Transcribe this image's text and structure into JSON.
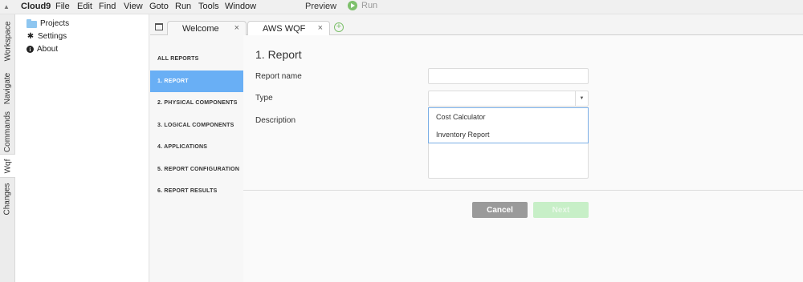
{
  "menubar": {
    "brand": "Cloud9",
    "menus": [
      "File",
      "Edit",
      "Find",
      "View",
      "Goto",
      "Run",
      "Tools",
      "Window"
    ],
    "preview": "Preview",
    "run": "Run",
    "run_icon": "play-icon"
  },
  "side_tabs": [
    "Workspace",
    "Navigate",
    "Commands",
    "Wqf",
    "Changes"
  ],
  "tree": {
    "items": [
      {
        "label": "Projects",
        "icon": "folder-icon"
      },
      {
        "label": "Settings",
        "icon": "gear-icon"
      },
      {
        "label": "About",
        "icon": "info-icon"
      }
    ]
  },
  "tabs": [
    {
      "label": "Welcome",
      "close": "×"
    },
    {
      "label": "AWS WQF",
      "close": "×"
    }
  ],
  "add_tab": "+",
  "steps": [
    "ALL REPORTS",
    "1. REPORT",
    "2. PHYSICAL COMPONENTS",
    "3. LOGICAL COMPONENTS",
    "4. APPLICATIONS",
    "5. REPORT CONFIGURATION",
    "6. REPORT RESULTS"
  ],
  "active_step": "1. REPORT",
  "form": {
    "heading": "1. Report",
    "report_name_label": "Report name",
    "report_name_value": "",
    "type_label": "Type",
    "type_value": "",
    "description_label": "Description",
    "type_options": [
      "Cost Calculator",
      "Inventory Report"
    ]
  },
  "buttons": {
    "cancel": "Cancel",
    "next": "Next"
  },
  "colors": {
    "active_step": "#69aff5",
    "run_accent": "#7dc06b",
    "cancel": "#9a9a9a",
    "next_disabled": "#c7efc7",
    "dropdown_border": "#7aaee6"
  }
}
